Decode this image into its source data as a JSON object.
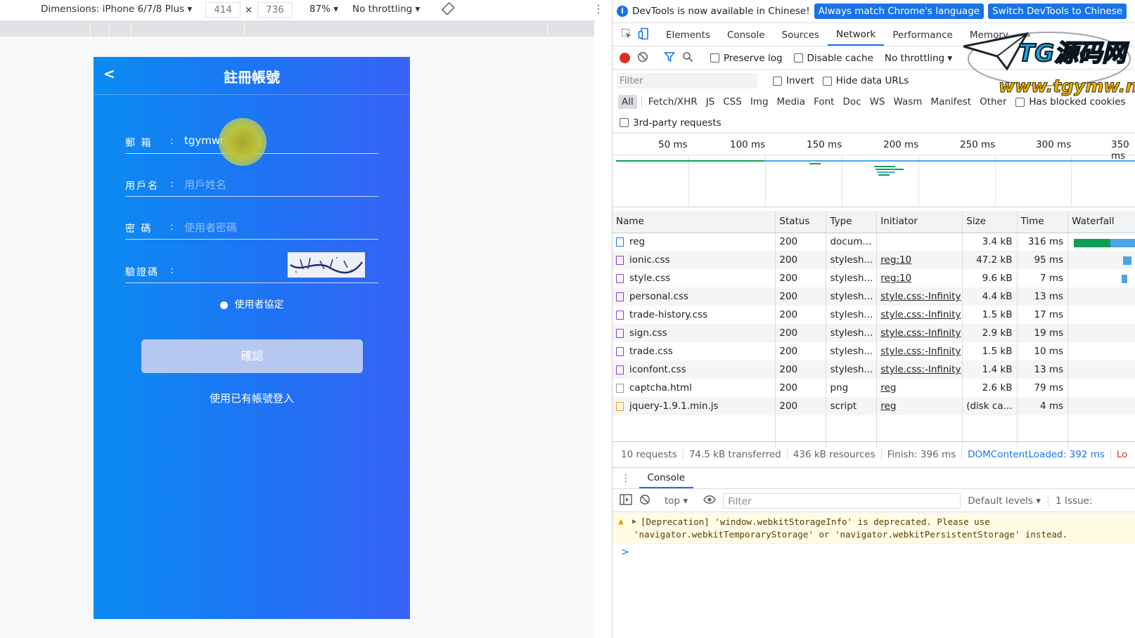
{
  "device_toolbar": {
    "dimensions_label": "Dimensions: iPhone 6/7/8 Plus",
    "width_value": "414",
    "times": "×",
    "height_value": "736",
    "zoom": "87%",
    "throttling": "No throttling"
  },
  "phone": {
    "back": "<",
    "title": "註冊帳號",
    "email_label": "郵 箱",
    "email_value": "tgymwnet@qq",
    "username_label": "用戶名",
    "username_placeholder": "用戶姓名",
    "password_label": "密 碼",
    "password_placeholder": "使用者密碼",
    "captcha_label": "驗證碼",
    "colon": ":",
    "agreement": "使用者協定",
    "confirm": "確認",
    "login_link": "使用已有帳號登入"
  },
  "devtools": {
    "banner_text": "DevTools is now available in Chinese!",
    "banner_btn1": "Always match Chrome's language",
    "banner_btn2": "Switch DevTools to Chinese",
    "tabs": [
      "Elements",
      "Console",
      "Sources",
      "Network",
      "Performance",
      "Memory"
    ],
    "active_tab": "Network",
    "more_tabs": "»",
    "preserve_log": "Preserve log",
    "disable_cache": "Disable cache",
    "throttle": "No throttling",
    "filter_placeholder": "Filter",
    "invert": "Invert",
    "hide_data_urls": "Hide data URLs",
    "types": [
      "All",
      "Fetch/XHR",
      "JS",
      "CSS",
      "Img",
      "Media",
      "Font",
      "Doc",
      "WS",
      "Wasm",
      "Manifest",
      "Other"
    ],
    "blocked_cookies": "Has blocked cookies",
    "third_party": "3rd-party requests",
    "timeline_ticks": [
      "50 ms",
      "100 ms",
      "150 ms",
      "200 ms",
      "250 ms",
      "300 ms",
      "350 ms"
    ],
    "columns": [
      "Name",
      "Status",
      "Type",
      "Initiator",
      "Size",
      "Time",
      "Waterfall"
    ],
    "rows": [
      {
        "name": "reg",
        "status": "200",
        "type": "docum...",
        "initiator": "",
        "size": "3.4 kB",
        "time": "316 ms",
        "icon": "doc"
      },
      {
        "name": "ionic.css",
        "status": "200",
        "type": "stylesh...",
        "initiator": "reg:10",
        "size": "47.2 kB",
        "time": "95 ms",
        "icon": "css"
      },
      {
        "name": "style.css",
        "status": "200",
        "type": "stylesh...",
        "initiator": "reg:10",
        "size": "9.6 kB",
        "time": "7 ms",
        "icon": "css"
      },
      {
        "name": "personal.css",
        "status": "200",
        "type": "stylesh...",
        "initiator": "style.css:-Infinity",
        "size": "4.4 kB",
        "time": "13 ms",
        "icon": "css"
      },
      {
        "name": "trade-history.css",
        "status": "200",
        "type": "stylesh...",
        "initiator": "style.css:-Infinity",
        "size": "1.5 kB",
        "time": "17 ms",
        "icon": "css"
      },
      {
        "name": "sign.css",
        "status": "200",
        "type": "stylesh...",
        "initiator": "style.css:-Infinity",
        "size": "2.9 kB",
        "time": "19 ms",
        "icon": "css"
      },
      {
        "name": "trade.css",
        "status": "200",
        "type": "stylesh...",
        "initiator": "style.css:-Infinity",
        "size": "1.5 kB",
        "time": "10 ms",
        "icon": "css"
      },
      {
        "name": "iconfont.css",
        "status": "200",
        "type": "stylesh...",
        "initiator": "style.css:-Infinity",
        "size": "1.4 kB",
        "time": "13 ms",
        "icon": "css"
      },
      {
        "name": "captcha.html",
        "status": "200",
        "type": "png",
        "initiator": "reg",
        "size": "2.6 kB",
        "time": "79 ms",
        "icon": "img"
      },
      {
        "name": "jquery-1.9.1.min.js",
        "status": "200",
        "type": "script",
        "initiator": "reg",
        "size": "(disk ca...",
        "time": "4 ms",
        "icon": "js"
      }
    ],
    "summary": {
      "requests": "10 requests",
      "transferred": "74.5 kB transferred",
      "resources": "436 kB resources",
      "finish": "Finish: 396 ms",
      "dcl": "DOMContentLoaded: 392 ms",
      "load": "Lo"
    },
    "drawer_tab": "Console",
    "context": "top",
    "console_filter": "Filter",
    "levels": "Default levels",
    "issues": "1 Issue:",
    "warning_line1": "[Deprecation] 'window.webkitStorageInfo' is deprecated. Please use",
    "warning_line2": "'navigator.webkitTemporaryStorage' or 'navigator.webkitPersistentStorage' instead.",
    "prompt": ">"
  },
  "watermark": {
    "line1": "TG源码网",
    "line2": "www.tgymw.net"
  },
  "colors": {
    "accent": "#1a73e8",
    "phone_start": "#0a8cf2",
    "phone_end": "#3863f6"
  }
}
